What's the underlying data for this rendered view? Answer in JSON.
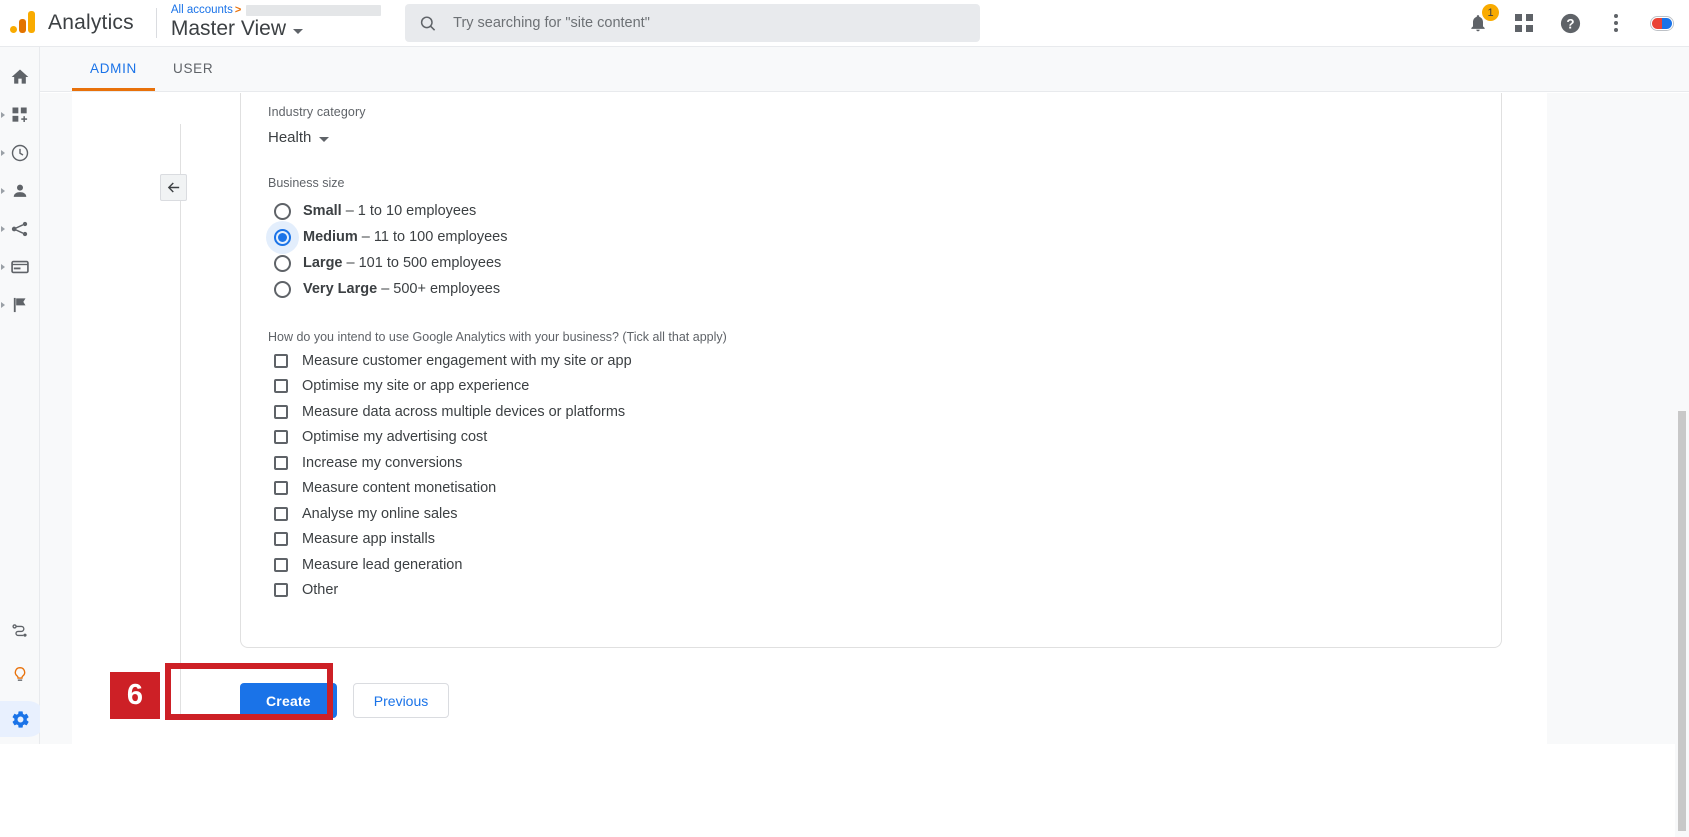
{
  "header": {
    "brand": "Analytics",
    "breadcrumb_root": "All accounts",
    "breadcrumb_separator": ">",
    "view_name": "Master View",
    "search_placeholder": "Try searching for \"site content\"",
    "notification_count": "1",
    "icons": {
      "notifications": "bell-icon",
      "apps": "apps-grid-icon",
      "help": "help-icon",
      "more": "kebab-menu-icon",
      "account": "avatar-icon"
    }
  },
  "rail": {
    "items": [
      {
        "name": "home",
        "icon": "home-icon",
        "expandable": false,
        "active": false
      },
      {
        "name": "customisation",
        "icon": "customisation-icon",
        "expandable": true,
        "active": false
      },
      {
        "name": "realtime",
        "icon": "clock-icon",
        "expandable": true,
        "active": false
      },
      {
        "name": "audience",
        "icon": "person-icon",
        "expandable": true,
        "active": false
      },
      {
        "name": "acquisition",
        "icon": "share-nodes-icon",
        "expandable": true,
        "active": false
      },
      {
        "name": "behaviour",
        "icon": "card-icon",
        "expandable": true,
        "active": false
      },
      {
        "name": "conversions",
        "icon": "flag-icon",
        "expandable": true,
        "active": false
      }
    ],
    "bottom_items": [
      {
        "name": "attribution",
        "icon": "attribution-path-icon",
        "active": false
      },
      {
        "name": "discover",
        "icon": "lightbulb-icon",
        "active": false
      },
      {
        "name": "admin",
        "icon": "gear-icon",
        "active": true
      }
    ]
  },
  "tabs": [
    {
      "label": "ADMIN",
      "active": true
    },
    {
      "label": "USER",
      "active": false
    }
  ],
  "form": {
    "industry": {
      "label": "Industry category",
      "value": "Health"
    },
    "business_size": {
      "label": "Business size",
      "selected": "Medium",
      "options": [
        {
          "name": "Small",
          "title": "Small",
          "detail": " – 1 to 10 employees",
          "checked": false
        },
        {
          "name": "Medium",
          "title": "Medium",
          "detail": " – 11 to 100 employees",
          "checked": true
        },
        {
          "name": "Large",
          "title": "Large",
          "detail": " – 101 to 500 employees",
          "checked": false
        },
        {
          "name": "Very Large",
          "title": "Very Large",
          "detail": " – 500+ employees",
          "checked": false
        }
      ]
    },
    "intent": {
      "label": "How do you intend to use Google Analytics with your business? (Tick all that apply)",
      "options": [
        {
          "label": "Measure customer engagement with my site or app",
          "checked": false
        },
        {
          "label": "Optimise my site or app experience",
          "checked": false
        },
        {
          "label": "Measure data across multiple devices or platforms",
          "checked": false
        },
        {
          "label": "Optimise my advertising cost",
          "checked": false
        },
        {
          "label": "Increase my conversions",
          "checked": false
        },
        {
          "label": "Measure content monetisation",
          "checked": false
        },
        {
          "label": "Analyse my online sales",
          "checked": false
        },
        {
          "label": "Measure app installs",
          "checked": false
        },
        {
          "label": "Measure lead generation",
          "checked": false
        },
        {
          "label": "Other",
          "checked": false
        }
      ]
    }
  },
  "actions": {
    "create_label": "Create",
    "previous_label": "Previous",
    "back_icon": "arrow-left-icon"
  },
  "annotation": {
    "step_number": "6",
    "colour": "#cd2026",
    "target": "Create"
  },
  "colours": {
    "accent_blue": "#1a73e8",
    "tab_underline_orange": "#e8710a",
    "logo_orange": "#f9ab00",
    "badge_yellow": "#f9ab00"
  }
}
